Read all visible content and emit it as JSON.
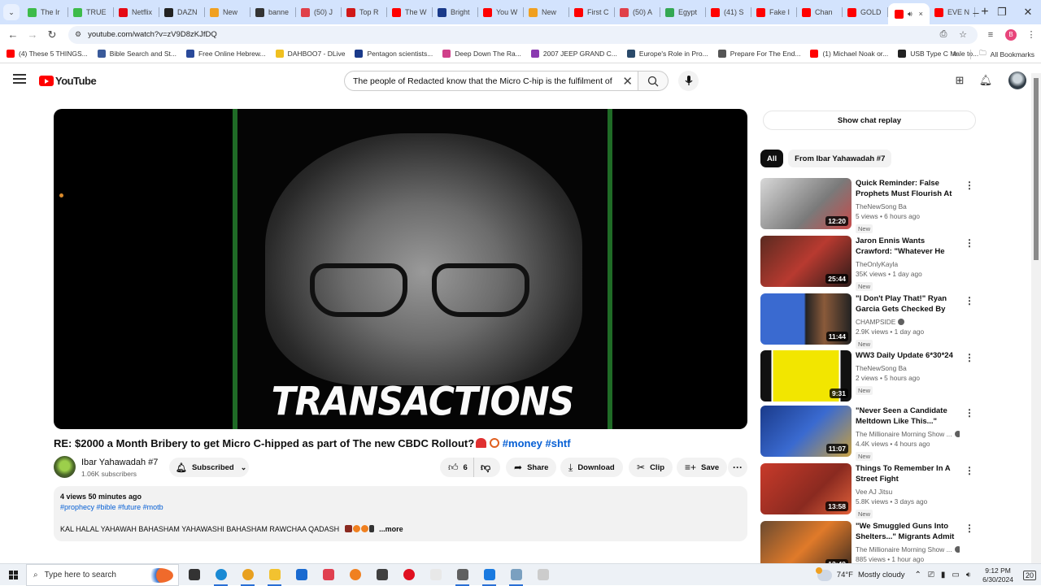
{
  "browser": {
    "tabs": [
      {
        "label": "The Ir",
        "color": "#3dbb4a"
      },
      {
        "label": "TRUE",
        "color": "#3dbb4a"
      },
      {
        "label": "Netflix",
        "color": "#e50914"
      },
      {
        "label": "DAZN",
        "color": "#222222"
      },
      {
        "label": "New",
        "color": "#f0a020"
      },
      {
        "label": "banne",
        "color": "#333333"
      },
      {
        "label": "(50) J",
        "color": "#e0404a"
      },
      {
        "label": "Top R",
        "color": "#d01818"
      },
      {
        "label": "The W",
        "color": "#ff0000"
      },
      {
        "label": "Bright",
        "color": "#1a3a8a"
      },
      {
        "label": "You W",
        "color": "#ff0000"
      },
      {
        "label": "New",
        "color": "#f0a020"
      },
      {
        "label": "First C",
        "color": "#ff0000"
      },
      {
        "label": "(50) A",
        "color": "#e0404a"
      },
      {
        "label": "Egypt",
        "color": "#34a853"
      },
      {
        "label": "(41) S",
        "color": "#ff0000"
      },
      {
        "label": "Fake I",
        "color": "#ff0000"
      },
      {
        "label": "Chan",
        "color": "#ff0000"
      },
      {
        "label": "GOLD",
        "color": "#ff0000"
      }
    ],
    "active_tab": {
      "audio_icon": "speaker-icon",
      "close": "×"
    },
    "after_tabs": [
      {
        "label": "EVE N",
        "color": "#ff0000"
      }
    ],
    "new_tab": "+",
    "window_controls": {
      "minimize": "–",
      "maximize": "❐",
      "close": "✕"
    },
    "url": "youtube.com/watch?v=zV9D8zKJfDQ",
    "profile_initial": "B",
    "bookmarks": [
      {
        "label": "(4) These 5 THINGS...",
        "color": "#ff0000"
      },
      {
        "label": "Bible Search and St...",
        "color": "#3a5a9a"
      },
      {
        "label": "Free Online Hebrew...",
        "color": "#2a4a9a"
      },
      {
        "label": "DAHBOO7 - DLive",
        "color": "#f0c020"
      },
      {
        "label": "Pentagon scientists...",
        "color": "#1a3a8a"
      },
      {
        "label": "Deep Down The Ra...",
        "color": "#d0408a"
      },
      {
        "label": "2007 JEEP GRAND C...",
        "color": "#8a3ab0"
      },
      {
        "label": "Europe's Role in Pro...",
        "color": "#2a4a6a"
      },
      {
        "label": "Prepare For The End...",
        "color": "#555555"
      },
      {
        "label": "(1) Michael Noak or...",
        "color": "#ff0000"
      },
      {
        "label": "USB Type C Male to...",
        "color": "#222222"
      }
    ],
    "bookmarks_overflow": "»",
    "all_bookmarks": "All Bookmarks"
  },
  "youtube": {
    "logo_text": "YouTube",
    "search_value": "The people of Redacted know that the Micro C-hip is the fulfilment of",
    "video": {
      "overlay_caption": "TRANSACTIONS",
      "title_text": "RE: $2000 a Month Bribery to get Micro C-hipped as part of The new CBDC Rollout?",
      "title_tags": "#money #shtf",
      "channel_name": "Ibar Yahawadah #7",
      "subscribers": "1.06K subscribers",
      "subscribed_label": "Subscribed",
      "likes": "6",
      "share_label": "Share",
      "download_label": "Download",
      "clip_label": "Clip",
      "save_label": "Save",
      "more_label": "···"
    },
    "description": {
      "meta": "4 views  50 minutes ago",
      "hashtags": "#prophecy #bible #future #motb",
      "body": "KAL HALAL YAHAWAH BAHASHAM YAHAWASHI BAHASHAM RAWCHAA QADASH",
      "more": "...more"
    },
    "show_chat_replay": "Show chat replay",
    "chips": [
      "All",
      "From Ibar Yahawadah #7"
    ],
    "recommendations": [
      {
        "title": "Quick Reminder: False Prophets Must Flourish At The Last !",
        "channel": "TheNewSong Ba",
        "verified": false,
        "stats": "5 views  •  6 hours ago",
        "badge": "New",
        "duration": "12:20",
        "thumb": "linear-gradient(135deg,#d8d8d8,#7a7a7a 60%,#c84a4a)"
      },
      {
        "title": "Jaron Ennis Wants Crawford: \"Whatever He Thinks He Can...",
        "channel": "TheOnlyKayla",
        "verified": false,
        "stats": "35K views  •  1 day ago",
        "badge": "New",
        "duration": "25:44",
        "thumb": "linear-gradient(135deg,#5a2a20,#b83a30 50%,#2a1a18)"
      },
      {
        "title": "\"I Don't Play That!\" Ryan Garcia Gets Checked By Zab Judah...",
        "channel": "CHAMPSIDE",
        "verified": true,
        "stats": "2.9K views  •  1 day ago",
        "badge": "New",
        "duration": "11:44",
        "thumb": "linear-gradient(90deg,#3a6ad0 0 48%,#222 50%,#8a5a3a 70%,#222)"
      },
      {
        "title": "WW3 Daily Update 6*30*24",
        "channel": "TheNewSong Ba",
        "verified": false,
        "stats": "2 views  •  5 hours ago",
        "badge": "New",
        "duration": "9:31",
        "thumb": "linear-gradient(90deg,#111 0 12%,#fff 12% 14%,#f2e600 14% 86%,#fff 86% 88%,#111 88%)"
      },
      {
        "title": "\"Never Seen a Candidate Meltdown Like This...\" Even...",
        "channel": "The Millionaire Morning Show ...",
        "verified": true,
        "stats": "4.4K views  •  4 hours ago",
        "badge": "New",
        "duration": "11:07",
        "thumb": "linear-gradient(135deg,#1a3a8a,#3a6ad0 50%,#c8a040)"
      },
      {
        "title": "Things To Remember In A Street Fight",
        "channel": "Vee AJ Jitsu",
        "verified": false,
        "stats": "5.8K views  •  3 days ago",
        "badge": "New",
        "duration": "13:58",
        "thumb": "linear-gradient(135deg,#c83a2a,#8a2a20 60%,#e0603a)"
      },
      {
        "title": "\"We Smuggled Guns Into Shelters...\" Migrants Admit To...",
        "channel": "The Millionaire Morning Show ...",
        "verified": true,
        "stats": "885 views  •  1 hour ago",
        "badge": "",
        "duration": "12:49",
        "thumb": "linear-gradient(135deg,#6a4a30,#e07a2a 50%,#3a2a20)"
      }
    ]
  },
  "taskbar": {
    "search_placeholder": "Type here to search",
    "weather_temp": "74°F",
    "weather_desc": "Mostly cloudy",
    "time": "9:12 PM",
    "date": "6/30/2024",
    "notification_count": "20",
    "apps": [
      {
        "name": "task-view",
        "color": "#333333",
        "open": false
      },
      {
        "name": "edge",
        "color": "#1a8ad4",
        "open": true
      },
      {
        "name": "chrome",
        "color": "#e8a020",
        "open": true
      },
      {
        "name": "file-explorer",
        "color": "#f2c230",
        "open": true
      },
      {
        "name": "mail",
        "color": "#1a6ad0",
        "open": false
      },
      {
        "name": "app-a",
        "color": "#e04050",
        "open": false
      },
      {
        "name": "app-b",
        "color": "#f08020",
        "open": false
      },
      {
        "name": "app-c",
        "color": "#404040",
        "open": false
      },
      {
        "name": "opera",
        "color": "#e01020",
        "open": false
      },
      {
        "name": "notepad",
        "color": "#e8e8e8",
        "open": false
      },
      {
        "name": "app-d",
        "color": "#606060",
        "open": true
      },
      {
        "name": "downloader",
        "color": "#1a7ae0",
        "open": true
      },
      {
        "name": "app-e",
        "color": "#7aa0c0",
        "open": true
      },
      {
        "name": "app-f",
        "color": "#cccccc",
        "open": false
      }
    ]
  }
}
